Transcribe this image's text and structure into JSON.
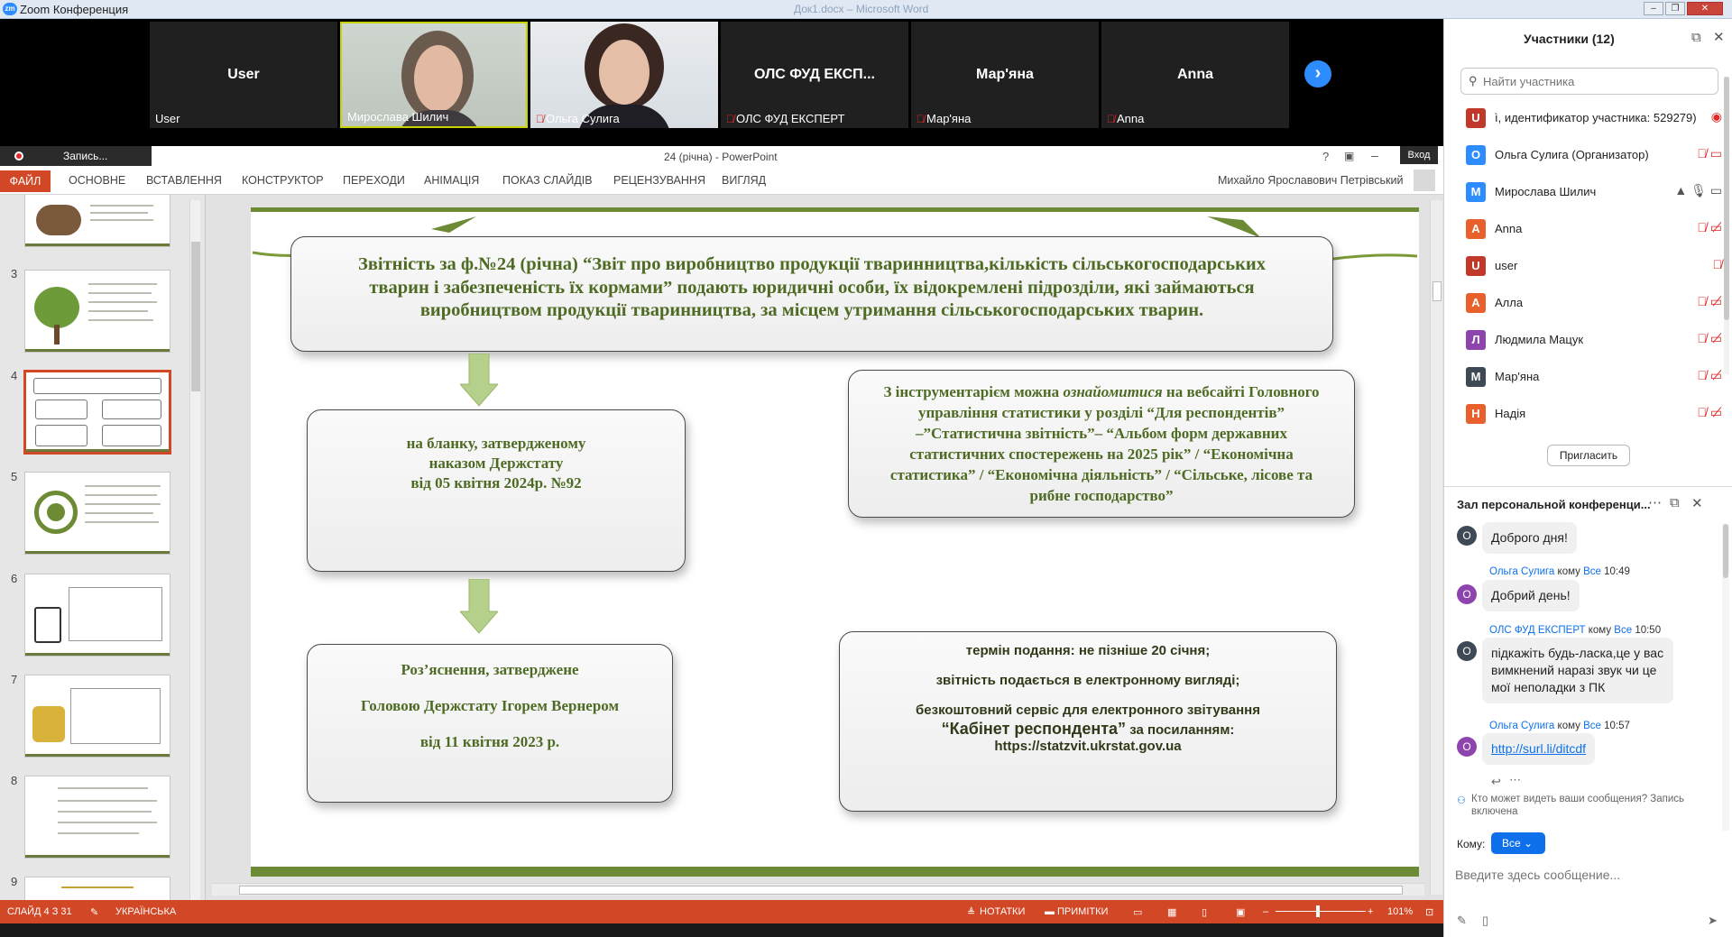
{
  "window": {
    "title": "Zoom Конференция",
    "background_title": "Док1.docx – Microsoft Word",
    "controls": [
      "–",
      "❐",
      "✕"
    ]
  },
  "video_strip": {
    "tiles": [
      {
        "name": "User",
        "label": "User",
        "muted": false,
        "video": false
      },
      {
        "name": "",
        "label": "Мирослава Шилич",
        "muted": false,
        "video": true
      },
      {
        "name": "",
        "label": "Ольга Сулига",
        "muted": true,
        "video": true
      },
      {
        "name": "ОЛС ФУД ЕКСП...",
        "label": "ОЛС ФУД ЕКСПЕРТ",
        "muted": true,
        "video": false
      },
      {
        "name": "Мар'яна",
        "label": "Мар'яна",
        "muted": true,
        "video": false
      },
      {
        "name": "Anna",
        "label": "Anna",
        "muted": true,
        "video": false
      }
    ],
    "next_arrow": "›"
  },
  "powerpoint": {
    "recording_label": "Запись...",
    "doc_title": "24 (річна) - PowerPoint",
    "help": "?",
    "vhod": "Вход",
    "file_tab": "ФАЙЛ",
    "tabs": [
      "ОСНОВНЕ",
      "ВСТАВЛЕННЯ",
      "КОНСТРУКТОР",
      "ПЕРЕХОДИ",
      "АНІМАЦІЯ",
      "ПОКАЗ СЛАЙДІВ",
      "РЕЦЕНЗУВАННЯ",
      "ВИГЛЯД"
    ],
    "user_name": "Михайло Ярославович Петрівський",
    "thumb_numbers": [
      "3",
      "4",
      "5",
      "6",
      "7",
      "8",
      "9"
    ],
    "slide": {
      "box_top": "Звітність за ф.№24 (річна) “Звіт про виробництво продукції тваринництва,кількість сільськогосподарських тварин і забезпеченість їх кормами” подають юридичні особи, їх відокремлені підрозділи, які займаються виробництвом продукції тваринництва, за місцем утримання сільськогосподарських тварин.",
      "box_left1": [
        "на бланку, затвердженому",
        "наказом Держстату",
        "від 05 квітня 2024р. №92"
      ],
      "box_left2": [
        "Роз’яснення, затверджене",
        "Головою Держстату Ігорем Вернером",
        "від 11 квітня 2023 р."
      ],
      "box_right1_prefix": "З інструментарієм можна",
      "box_right1_italic": "ознайомитися",
      "box_right1_rest": "на вебсайті Головного управління статистики у розділі “Для респондентів” –”Статистична звітність”– “Альбом форм державних статистичних спостережень на 2025 рік” / “Економічна статистика” / “Економічна діяльність” / “Сільське, лісове та рибне господарство”",
      "box_right2": {
        "line1": "термін подання: не пізніше 20 січня;",
        "line2": "звітність подається в електронному вигляді;",
        "line3": "безкоштовний сервіс для електронного звітування",
        "line4_a": "“Кабінет респондента”",
        "line4_b": " за посиланням:",
        "line5": "https://statzvit.ukrstat.gov.ua"
      }
    },
    "status": {
      "slide": "СЛАЙД 4 З 31",
      "language": "УКРАЇНСЬКА",
      "notes": "НОТАТКИ",
      "comments": "ПРИМІТКИ",
      "zoom": "101%"
    }
  },
  "participants": {
    "title": "Участники (12)",
    "search_placeholder": "Найти участника",
    "list": [
      {
        "initial": "U",
        "name": "ì, идентификатор участника: 529279)",
        "color": "#c0392b",
        "icons": "◉"
      },
      {
        "initial": "О",
        "name": "Ольга Сулига (Организатор)",
        "color": "#2d8cff",
        "icons": "🎙̸  ▭"
      },
      {
        "initial": "М",
        "name": "Мирослава Шилич",
        "color": "#2d8cff",
        "icons": "▲ 🎙 ▭"
      },
      {
        "initial": "А",
        "name": "Anna",
        "color": "#e8612c",
        "icons": "🎙̸  ▭̸"
      },
      {
        "initial": "U",
        "name": "user",
        "color": "#c0392b",
        "icons": "🎙̸"
      },
      {
        "initial": "А",
        "name": "Алла",
        "color": "#e8612c",
        "icons": "🎙̸  ▭̸"
      },
      {
        "initial": "Л",
        "name": "Людмила Мацук",
        "color": "#8e44ad",
        "icons": "🎙̸  ▭̸"
      },
      {
        "initial": "М",
        "name": "Мар'яна",
        "color": "#3d4a55",
        "icons": "🎙̸  ▭̸"
      },
      {
        "initial": "Н",
        "name": "Надія",
        "color": "#e8612c",
        "icons": "🎙̸  ▭̸"
      }
    ],
    "invite_label": "Пригласить"
  },
  "chat": {
    "title": "Зал персональной конференци...",
    "messages": [
      {
        "avatar": "О",
        "color": "#3d4a55",
        "sender": "",
        "to": "",
        "time": "",
        "text": "Доброго дня!"
      },
      {
        "avatar": "О",
        "color": "#8e44ad",
        "sender": "Ольга Сулига",
        "to": "Все",
        "time": "10:49",
        "text": "Добрий день!"
      },
      {
        "avatar": "О",
        "color": "#3d4a55",
        "sender": "ОЛС ФУД ЕКСПЕРТ",
        "to": "Все",
        "time": "10:50",
        "text": "підкажіть будь-ласка,це у вас вимкнений наразі звук чи це мої неполадки з ПК"
      },
      {
        "avatar": "О",
        "color": "#8e44ad",
        "sender": "Ольга Сулига",
        "to": "Все",
        "time": "10:57",
        "text": "http://surl.li/ditcdf"
      }
    ],
    "to_word": "кому",
    "visibility_note": "Кто может видеть ваши сообщения? Запись включена",
    "to_label": "Кому:",
    "to_value": "Все",
    "input_placeholder": "Введите здесь сообщение..."
  }
}
